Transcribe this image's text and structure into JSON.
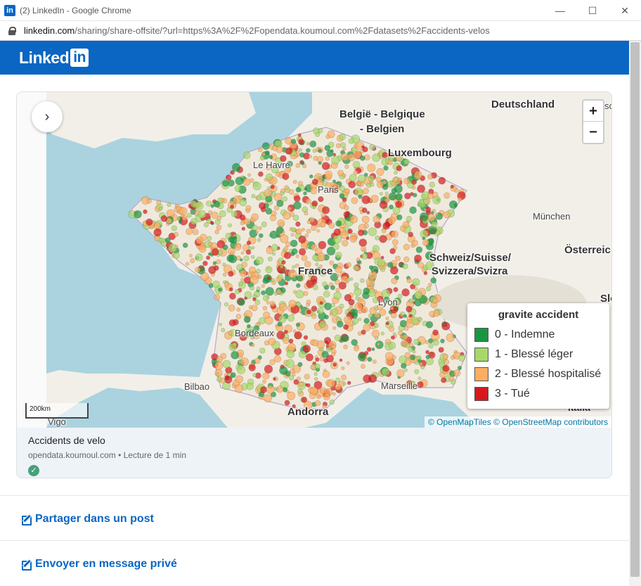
{
  "window": {
    "title": "(2) LinkedIn - Google Chrome",
    "app_icon": "in"
  },
  "urlbar": {
    "host": "linkedin.com",
    "path": "/sharing/share-offsite/?url=https%3A%2F%2Fopendata.koumoul.com%2Fdatasets%2Faccidents-velos"
  },
  "header": {
    "brand_text": "Linked",
    "brand_badge": "in"
  },
  "map": {
    "zoom_in": "+",
    "zoom_out": "−",
    "nav_arrow": "›",
    "scale_label": "200km",
    "attribution": "© OpenMapTiles © OpenStreetMap contributors",
    "labels": {
      "belgie": "België - Belgique",
      "belgien": "- Belgien",
      "deutschland": "Deutschland",
      "luxembourg": "Luxembourg",
      "le_havre": "Le Havre",
      "paris": "Paris",
      "munchen": "München",
      "osterreich": "Österreic",
      "schweiz1": "Schweiz/Suisse/",
      "schweiz2": "Svizzera/Svizra",
      "france": "France",
      "lyon": "Lyon",
      "bordeaux": "Bordeaux",
      "bilbao": "Bilbao",
      "marseille": "Marseille",
      "andorra": "Andorra",
      "vigo": "Vigo",
      "italia": "Italia",
      "slo": "Slo",
      "sc": "sc"
    },
    "legend": {
      "title": "gravite accident",
      "items": [
        {
          "label": "0 - Indemne",
          "color": "#1a9641"
        },
        {
          "label": "1 - Blessé léger",
          "color": "#a6d96a"
        },
        {
          "label": "2 - Blessé hospitalisé",
          "color": "#fdae61"
        },
        {
          "label": "3 - Tué",
          "color": "#d7191c"
        }
      ]
    }
  },
  "card": {
    "title": "Accidents de velo",
    "source": "opendata.koumoul.com • Lecture de 1 min",
    "verified_icon": "✓"
  },
  "actions": {
    "share_post": "Partager dans un post",
    "send_message": "Envoyer en message privé"
  }
}
